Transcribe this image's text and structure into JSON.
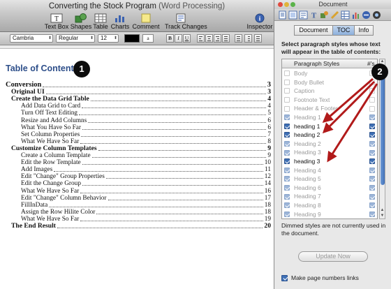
{
  "window": {
    "title": "Converting the Stock Program",
    "subtitle": "(Word Processing)"
  },
  "toolbar": {
    "buttons": [
      {
        "label": "Text Box",
        "icon": "text-box-icon"
      },
      {
        "label": "Shapes",
        "icon": "shapes-icon"
      },
      {
        "label": "Table",
        "icon": "table-icon"
      },
      {
        "label": "Charts",
        "icon": "charts-icon"
      },
      {
        "label": "Comment",
        "icon": "comment-icon"
      },
      {
        "label": "Track Changes",
        "icon": "track-changes-icon"
      },
      {
        "label": "Inspector",
        "icon": "inspector-icon"
      }
    ]
  },
  "format_bar": {
    "font_family": "Cambria",
    "font_style": "Regular",
    "font_size": "12",
    "text_color": "#000000",
    "highlight_label": "a",
    "bold_label": "B",
    "italic_label": "I",
    "underline_label": "U"
  },
  "document": {
    "toc_heading": "Table of Contents",
    "entries": [
      {
        "level": 1,
        "text": "Conversion",
        "page": "3"
      },
      {
        "level": 2,
        "text": "Original UI",
        "page": "3"
      },
      {
        "level": 2,
        "text": "Create the Data Grid Table",
        "page": "4"
      },
      {
        "level": 3,
        "text": "Add Data Grid to Card",
        "page": "4"
      },
      {
        "level": 3,
        "text": "Turn Off Text Editing",
        "page": "5"
      },
      {
        "level": 3,
        "text": "Resize and Add Columns",
        "page": "6"
      },
      {
        "level": 3,
        "text": "What You Have So Far",
        "page": "6"
      },
      {
        "level": 3,
        "text": "Set Column Properties",
        "page": "7"
      },
      {
        "level": 3,
        "text": "What We Have So Far",
        "page": "8"
      },
      {
        "level": 2,
        "text": "Customize Column Templates",
        "page": "9"
      },
      {
        "level": 3,
        "text": "Create a Column Template",
        "page": "9"
      },
      {
        "level": 3,
        "text": "Edit the Row Template",
        "page": "10"
      },
      {
        "level": 3,
        "text": "Add Images",
        "page": "11"
      },
      {
        "level": 3,
        "text": "Edit \"Change\" Group Properties",
        "page": "12"
      },
      {
        "level": 3,
        "text": "Edit the Change Group",
        "page": "14"
      },
      {
        "level": 3,
        "text": "What We Have So Far",
        "page": "16"
      },
      {
        "level": 3,
        "text": "Edit \"Change\" Column Behavior",
        "page": "17"
      },
      {
        "level": 3,
        "text": "FillInData",
        "page": "18"
      },
      {
        "level": 3,
        "text": "Assign the Row Hilite Color",
        "page": "18"
      },
      {
        "level": 3,
        "text": "What We Have So Far",
        "page": "19"
      },
      {
        "level": 2,
        "text": "The End Result",
        "page": "20"
      }
    ]
  },
  "callouts": {
    "one": "1",
    "two": "2"
  },
  "inspector": {
    "title": "Document",
    "tabs": [
      {
        "label": "Document",
        "active": false
      },
      {
        "label": "TOC",
        "active": true
      },
      {
        "label": "Info",
        "active": false
      }
    ],
    "instructions": "Select paragraph styles whose text will appear in the table of contents:",
    "column_headers": {
      "name": "Paragraph Styles",
      "numbers": "#'s"
    },
    "styles": [
      {
        "name": "Body",
        "checked": false,
        "page_numbers": false,
        "dimmed": true
      },
      {
        "name": "Body Bullet",
        "checked": false,
        "page_numbers": false,
        "dimmed": true
      },
      {
        "name": "Caption",
        "checked": false,
        "page_numbers": false,
        "dimmed": true
      },
      {
        "name": "Footnote Text",
        "checked": false,
        "page_numbers": false,
        "dimmed": true
      },
      {
        "name": "Header & Footer",
        "checked": false,
        "page_numbers": false,
        "dimmed": true
      },
      {
        "name": "Heading 1",
        "checked": true,
        "page_numbers": true,
        "dimmed": true
      },
      {
        "name": "heading 1",
        "checked": true,
        "page_numbers": true,
        "dimmed": false
      },
      {
        "name": "heading 2",
        "checked": true,
        "page_numbers": true,
        "dimmed": false
      },
      {
        "name": "Heading 2",
        "checked": true,
        "page_numbers": true,
        "dimmed": true
      },
      {
        "name": "Heading 3",
        "checked": true,
        "page_numbers": true,
        "dimmed": true
      },
      {
        "name": "heading 3",
        "checked": true,
        "page_numbers": true,
        "dimmed": false
      },
      {
        "name": "Heading 4",
        "checked": true,
        "page_numbers": true,
        "dimmed": true
      },
      {
        "name": "Heading 5",
        "checked": true,
        "page_numbers": true,
        "dimmed": true
      },
      {
        "name": "Heading 6",
        "checked": true,
        "page_numbers": true,
        "dimmed": true
      },
      {
        "name": "Heading 7",
        "checked": true,
        "page_numbers": true,
        "dimmed": true
      },
      {
        "name": "Heading 8",
        "checked": true,
        "page_numbers": true,
        "dimmed": true
      },
      {
        "name": "Heading 9",
        "checked": true,
        "page_numbers": true,
        "dimmed": true
      }
    ],
    "dimmed_note": "Dimmed styles are not currently used in the document.",
    "update_button": "Update Now",
    "page_links_checkbox": {
      "label": "Make page numbers links",
      "checked": true
    }
  },
  "colors": {
    "toc_heading": "#2e4f8a",
    "checkbox_on": "#3e6fb4",
    "annotation_arrow": "#b11a1a",
    "badge": "#0c0c0c"
  }
}
